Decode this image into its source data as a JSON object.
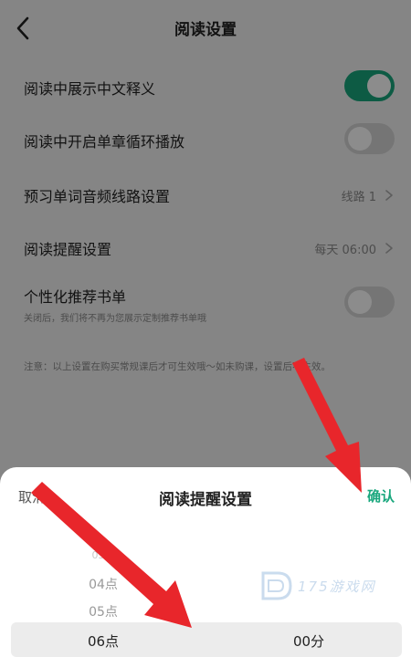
{
  "header": {
    "title": "阅读设置"
  },
  "settings": [
    {
      "label": "阅读中展示中文释义",
      "toggle": "on"
    },
    {
      "label": "阅读中开启单章循环播放",
      "toggle": "off"
    },
    {
      "label": "预习单词音频线路设置",
      "value": "线路 1"
    },
    {
      "label": "阅读提醒设置",
      "value": "每天 06:00"
    },
    {
      "label": "个性化推荐书单",
      "sublabel": "关闭后，我们将不再为您展示定制推荐书单哦",
      "toggle": "off"
    }
  ],
  "note": "注意：以上设置在购买常规课后才可生效哦～如未购课，设置后不生效。",
  "sheet": {
    "cancel_label": "取消",
    "title": "阅读提醒设置",
    "confirm_label": "确认",
    "hours": [
      "03点",
      "04点",
      "05点",
      "06点"
    ],
    "minutes_selected": "00分"
  },
  "watermark": {
    "text": "175游戏网"
  },
  "colors": {
    "accent": "#19a77d",
    "arrow": "#e8262b"
  }
}
